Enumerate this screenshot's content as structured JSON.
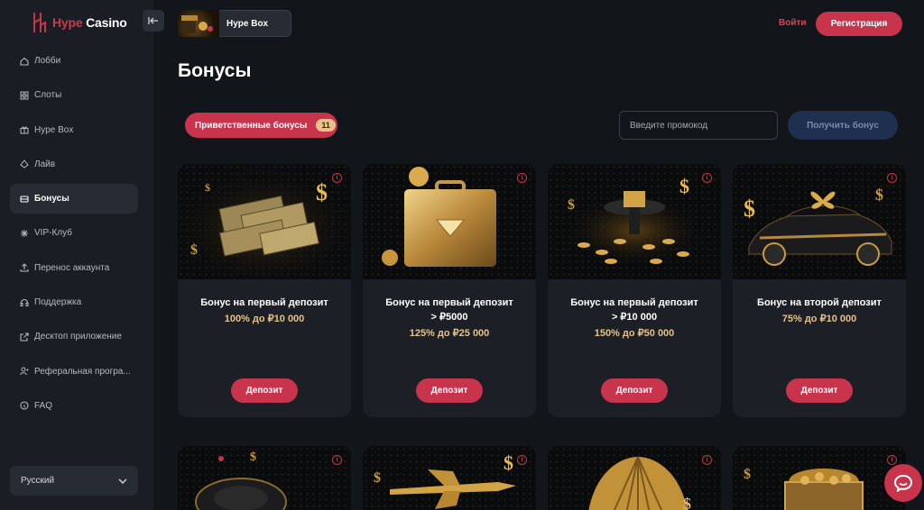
{
  "brand": {
    "name_part1": "Hype",
    "name_part2": " Casino"
  },
  "sidebar": {
    "items": [
      {
        "label": "Лобби",
        "icon": "home-icon"
      },
      {
        "label": "Слоты",
        "icon": "grid-icon"
      },
      {
        "label": "Hype Box",
        "icon": "gift-icon"
      },
      {
        "label": "Лайв",
        "icon": "spade-icon"
      },
      {
        "label": "Бонусы",
        "icon": "ticket-icon",
        "active": true
      },
      {
        "label": "VIP-Клуб",
        "icon": "vip-icon"
      },
      {
        "label": "Перенос аккаунта",
        "icon": "transfer-icon"
      },
      {
        "label": "Поддержка",
        "icon": "headset-icon"
      },
      {
        "label": "Десктоп приложение",
        "icon": "external-link-icon"
      },
      {
        "label": "Реферальная програ...",
        "icon": "referral-icon"
      },
      {
        "label": "FAQ",
        "icon": "info-icon"
      }
    ],
    "language": "Русский"
  },
  "header": {
    "hypebox_label": "Hype Box",
    "login": "Войти",
    "register": "Регистрация"
  },
  "main": {
    "title": "Бонусы",
    "filter_tab": {
      "label": "Приветственные бонусы",
      "count": "11"
    },
    "promo": {
      "placeholder": "Введите промокод"
    },
    "get_bonus": "Получить бонус",
    "cards": [
      {
        "title_line1": "Бонус на первый депозит",
        "title_line2": "",
        "subtitle": "100% до ₽10 000",
        "button": "Депозит"
      },
      {
        "title_line1": "Бонус на первый депозит",
        "title_line2": "> ₽5000",
        "subtitle": "125% до ₽25 000",
        "button": "Депозит"
      },
      {
        "title_line1": "Бонус на первый депозит",
        "title_line2": "> ₽10 000",
        "subtitle": "150% до ₽50 000",
        "button": "Депозит"
      },
      {
        "title_line1": "Бонус на второй депозит",
        "title_line2": "",
        "subtitle": "75% до ₽10 000",
        "button": "Депозит"
      }
    ]
  },
  "colors": {
    "accent": "#c8344b",
    "gold": "#e5c48a",
    "bg": "#121519",
    "sidebar": "#1a1d23",
    "card": "#1c1f25"
  }
}
